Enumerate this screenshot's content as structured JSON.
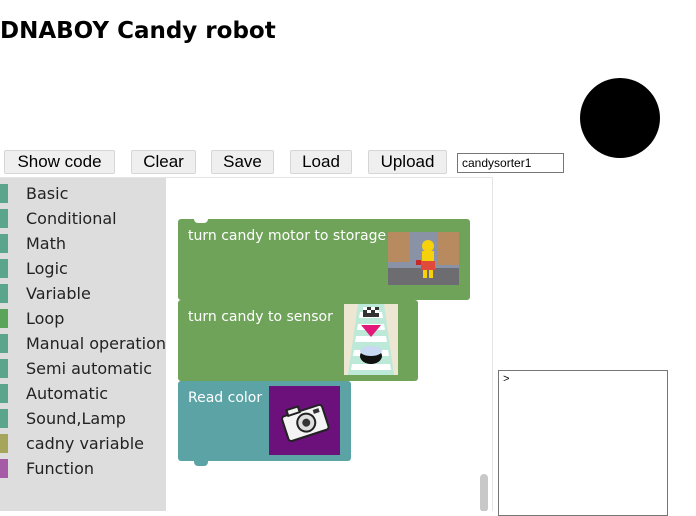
{
  "app": {
    "title": "DNABOY Candy robot"
  },
  "toolbar": {
    "show_code_label": "Show code",
    "clear_label": "Clear",
    "save_label": "Save",
    "load_label": "Load",
    "upload_label": "Upload",
    "filename_value": "candysorter1"
  },
  "toolbox": {
    "categories": [
      {
        "label": "Basic",
        "color": "#5ba58c"
      },
      {
        "label": "Conditional",
        "color": "#5ba58c"
      },
      {
        "label": "Math",
        "color": "#5ba58c"
      },
      {
        "label": "Logic",
        "color": "#5ba58c"
      },
      {
        "label": "Variable",
        "color": "#5ba58c"
      },
      {
        "label": "Loop",
        "color": "#5ba55b"
      },
      {
        "label": "Manual operation",
        "color": "#5ba58c"
      },
      {
        "label": "Semi automatic",
        "color": "#5ba58c"
      },
      {
        "label": "Automatic",
        "color": "#5ba58c"
      },
      {
        "label": "Sound,Lamp",
        "color": "#5ba58c"
      },
      {
        "label": "cadny variable",
        "color": "#a5a55b"
      },
      {
        "label": "Function",
        "color": "#a55ba5"
      }
    ]
  },
  "blocks": [
    {
      "label": "turn candy motor to storage",
      "color": "#6fa35a",
      "image": "cartoon-character-image"
    },
    {
      "label": "turn candy to sensor",
      "color": "#6fa35a",
      "image": "candy-sensor-image"
    },
    {
      "label": "Read color",
      "color": "#5ba3a5",
      "image": "camera-image"
    }
  ],
  "console": {
    "value": ">"
  },
  "colors": {
    "status_dot": "#000000",
    "toolbox_bg": "#dddddd"
  }
}
